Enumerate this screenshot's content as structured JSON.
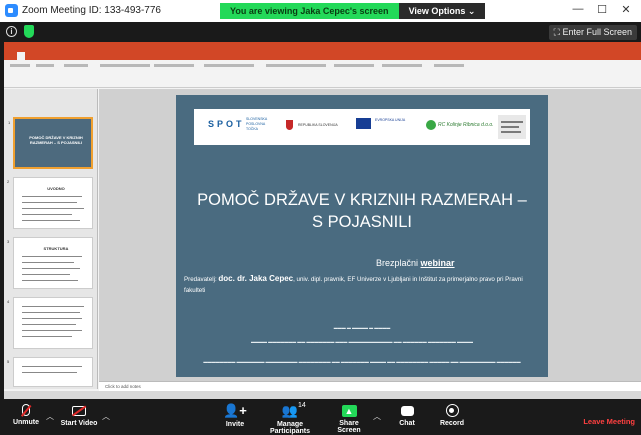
{
  "zoom": {
    "window_title": "Zoom Meeting ID: 133-493-776",
    "viewing_banner": "You are viewing Jaka Cepec's screen",
    "view_options": "View Options ⌄",
    "full_screen": "Enter Full Screen",
    "toolbar": {
      "unmute": "Unmute",
      "start_video": "Start Video",
      "invite": "Invite",
      "manage_participants": "Manage Participants",
      "participant_count": "14",
      "share_screen": "Share Screen",
      "chat": "Chat",
      "record": "Record",
      "leave": "Leave Meeting"
    },
    "colors": {
      "share_green": "#23d959",
      "leave_red": "#ff4040",
      "toolbar_bg": "#1a1a1a"
    }
  },
  "powerpoint": {
    "notes_placeholder": "Click to add notes",
    "slide": {
      "title": "POMOČ DRŽAVE V KRIZNIH RAZMERAH – S POJASNILI",
      "webinar_prefix": "Brezplačni ",
      "webinar_word": "webinar",
      "presenter_label": "Predavatelj: ",
      "presenter_name": "doc. dr. Jaka Cepec",
      "presenter_rest": ", univ. dipl. pravnik, EF Univerze v Ljubljani in Inštitut za primerjalno pravo pri Pravni fakulteti",
      "logos": {
        "spot": "SPOT",
        "spot_text": "SLOVENSKA POSLOVNA TOČKA",
        "republic": "REPUBLIKA SLOVENIJA",
        "eu": "EVROPSKA UNIJA",
        "rrc": "RC Kolinje Ribnica d.o.o."
      }
    },
    "thumbnails": [
      {
        "num": "1",
        "title": "POMOČ DRŽAVE V KRIZNIH RAZMERAH – S POJASNILI"
      },
      {
        "num": "2",
        "title": "UVODNO"
      },
      {
        "num": "3",
        "title": "STRUKTURA"
      },
      {
        "num": "4",
        "title": ""
      },
      {
        "num": "5",
        "title": ""
      }
    ]
  }
}
